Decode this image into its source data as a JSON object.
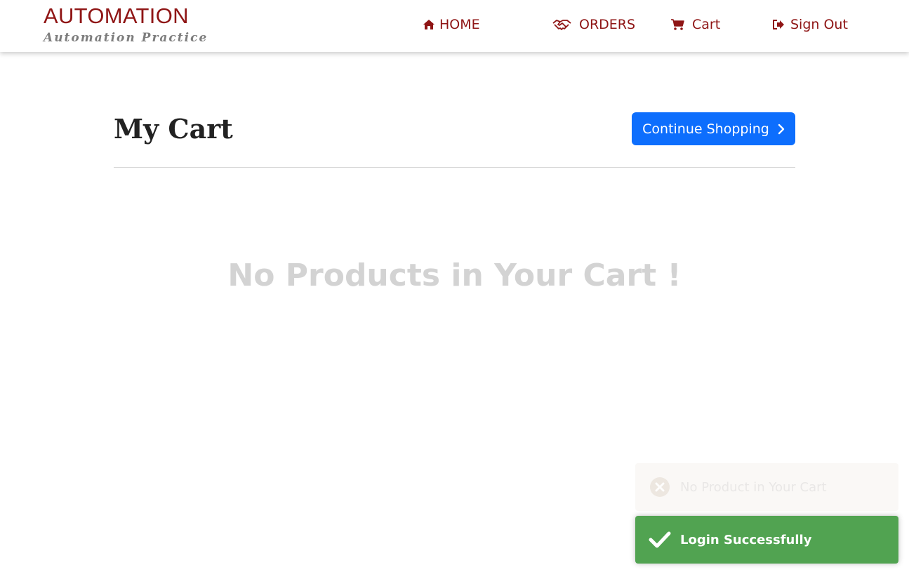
{
  "header": {
    "brand_title": "AUTOMATION",
    "brand_subtitle": "Automation Practice",
    "nav": {
      "home": {
        "label": "HOME",
        "icon": "home-icon"
      },
      "orders": {
        "label": "ORDERS",
        "icon": "handshake-icon"
      },
      "cart": {
        "label": "Cart",
        "icon": "shopping-cart-icon"
      },
      "sign_out": {
        "label": "Sign Out",
        "icon": "sign-out-icon"
      }
    }
  },
  "main": {
    "title": "My Cart",
    "continue_label": "Continue Shopping",
    "empty_message": "No Products in Your Cart !"
  },
  "toasts": [
    {
      "text": "No Product in Your Cart",
      "icon": "error-circle-icon",
      "state": "fading"
    },
    {
      "text": "Login Successfully",
      "icon": "checkmark-icon",
      "state": "visible"
    }
  ],
  "colors": {
    "brand": "#8f1515",
    "primary_button": "#0d6efd",
    "success_toast": "#51a351",
    "empty_text": "#d3d3d3"
  }
}
